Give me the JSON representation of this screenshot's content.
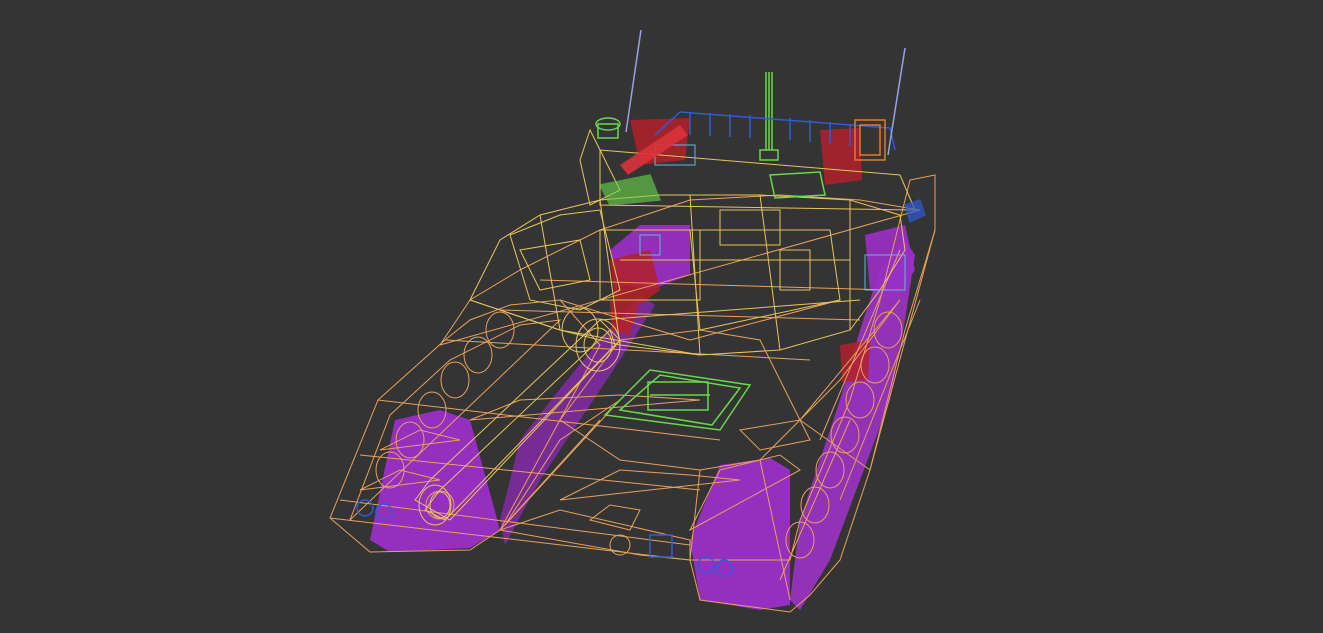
{
  "scene": {
    "subject": "tank-wireframe-model",
    "view": "3d-perspective-wireframe",
    "colors": {
      "background": "#343434",
      "hull_wire": "#e9a15b",
      "turret_wire": "#e8c55a",
      "tracks_fill": "#9b2fc7",
      "tracks_fill_light": "#b23ad8",
      "red_parts": "#b3212b",
      "green_parts": "#6ad84a",
      "blue_parts": "#2f5bd6",
      "antenna": "#9aa0e8",
      "cyan_parts": "#5fb8e0"
    }
  }
}
